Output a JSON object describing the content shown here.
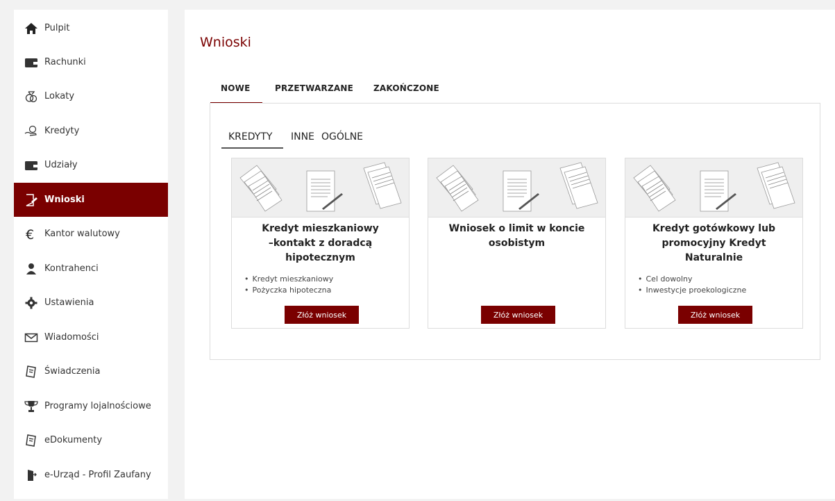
{
  "sidebar": {
    "items": [
      {
        "label": "Pulpit",
        "icon": "home-icon"
      },
      {
        "label": "Rachunki",
        "icon": "wallet-icon"
      },
      {
        "label": "Lokaty",
        "icon": "money-bag-icon"
      },
      {
        "label": "Kredyty",
        "icon": "hand-coin-icon"
      },
      {
        "label": "Udziały",
        "icon": "wallet-icon"
      },
      {
        "label": "Wnioski",
        "icon": "document-edit-icon",
        "active": true
      },
      {
        "label": "Kantor walutowy",
        "icon": "euro-icon"
      },
      {
        "label": "Kontrahenci",
        "icon": "person-icon"
      },
      {
        "label": "Ustawienia",
        "icon": "gear-icon"
      },
      {
        "label": "Wiadomości",
        "icon": "envelope-icon"
      },
      {
        "label": "Świadczenia",
        "icon": "notebook-icon"
      },
      {
        "label": "Programy lojalnościowe",
        "icon": "trophy-icon"
      },
      {
        "label": "eDokumenty",
        "icon": "notebook-icon"
      },
      {
        "label": "e-Urząd - Profil Zaufany",
        "icon": "door-icon"
      }
    ]
  },
  "main": {
    "title": "Wnioski",
    "tabs": [
      "NOWE",
      "PRZETWARZANE",
      "ZAKOŃCZONE"
    ],
    "subtabs": [
      "KREDYTY",
      "INNE",
      "OGÓLNE"
    ],
    "cards": [
      {
        "title_lines": [
          "Kredyt mieszkaniowy",
          "–kontakt z doradcą",
          "hipotecznym"
        ],
        "bullets": [
          "Kredyt mieszkaniowy",
          "Pożyczka hipoteczna"
        ],
        "button": "Złóż wniosek"
      },
      {
        "title_lines": [
          "Wniosek o limit w koncie",
          "osobistym"
        ],
        "bullets": [],
        "button": "Złóż wniosek"
      },
      {
        "title_lines": [
          "Kredyt gotówkowy lub",
          "promocyjny Kredyt",
          "Naturalnie"
        ],
        "bullets": [
          "Cel dowolny",
          "Inwestycje proekologiczne"
        ],
        "button": "Złóż wniosek"
      }
    ]
  },
  "colors": {
    "accent": "#7a0000",
    "background": "#f2f2f2",
    "panel": "#ffffff"
  }
}
